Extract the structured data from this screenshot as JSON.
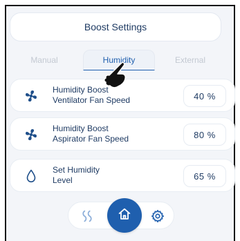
{
  "header": {
    "title": "Boost Settings"
  },
  "tabs": [
    {
      "label": "Manual",
      "active": false
    },
    {
      "label": "Humidity",
      "active": true
    },
    {
      "label": "External",
      "active": false
    }
  ],
  "settings": [
    {
      "label_line1": "Humidity Boost",
      "label_line2": "Ventilator Fan Speed",
      "value": "40",
      "unit": "%",
      "icon": "fan-icon"
    },
    {
      "label_line1": "Humidity Boost",
      "label_line2": "Aspirator Fan Speed",
      "value": "80",
      "unit": "%",
      "icon": "fan-icon"
    },
    {
      "label_line1": "Set Humidity",
      "label_line2": "Level",
      "value": "65",
      "unit": "%",
      "icon": "droplet-icon"
    }
  ],
  "nav": {
    "left_icon": "airflow-icon",
    "center_icon": "home-icon",
    "right_icon": "gear-icon"
  },
  "colors": {
    "accent": "#1f5fae",
    "text": "#1f3b63",
    "inactive_tab": "#c3c9d2"
  }
}
